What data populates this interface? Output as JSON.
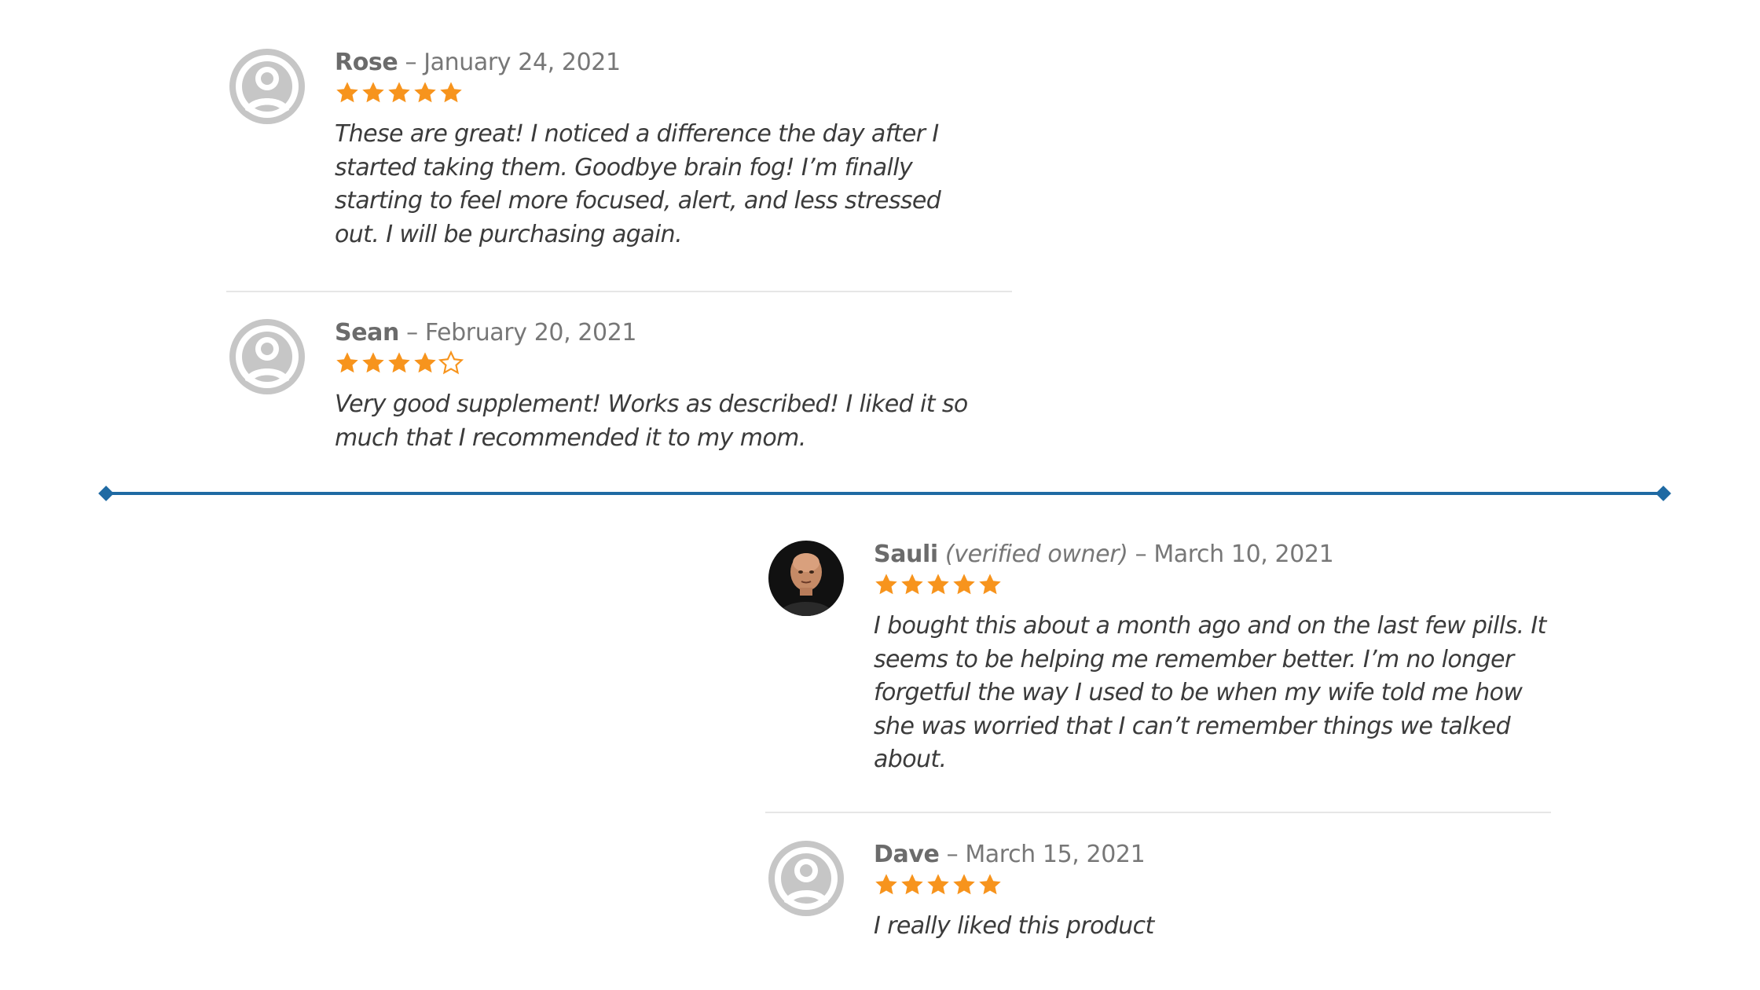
{
  "colors": {
    "star": "#f7941d",
    "divider": "#1f6aa3",
    "separator": "#e6e6e6",
    "meta_text": "#777777",
    "body_text": "#3b3b3b"
  },
  "reviews": [
    {
      "author": "Rose",
      "verified": "",
      "date_sep": " – ",
      "date": "January 24, 2021",
      "rating": 5,
      "stars_display": "5 of 5 stars",
      "avatar_icon": "default-avatar-icon",
      "text": "These are great! I noticed a difference the day after I started taking them. Goodbye brain fog! I’m finally starting to feel more focused, alert, and less stressed out. I will be purchasing again."
    },
    {
      "author": "Sean",
      "verified": "",
      "date_sep": " – ",
      "date": "February 20, 2021",
      "rating": 4,
      "stars_display": "4 of 5 stars",
      "avatar_icon": "default-avatar-icon",
      "text": "Very good supplement! Works as described! I liked it so much that I recommended it to my mom."
    },
    {
      "author": "Sauli",
      "verified": " (verified owner)",
      "date_sep": " – ",
      "date": "March 10, 2021",
      "rating": 5,
      "stars_display": "5 of 5 stars",
      "avatar_icon": "user-photo-icon",
      "text": "I bought this about a month ago and on the last few pills. It seems to be helping me remember better. I’m no longer forgetful the way I used to be when my wife told me how she was worried that I can’t remember things we talked about."
    },
    {
      "author": "Dave",
      "verified": "",
      "date_sep": " – ",
      "date": "March 15, 2021",
      "rating": 5,
      "stars_display": "5 of 5 stars",
      "avatar_icon": "default-avatar-icon",
      "text": "I really liked this product"
    }
  ]
}
